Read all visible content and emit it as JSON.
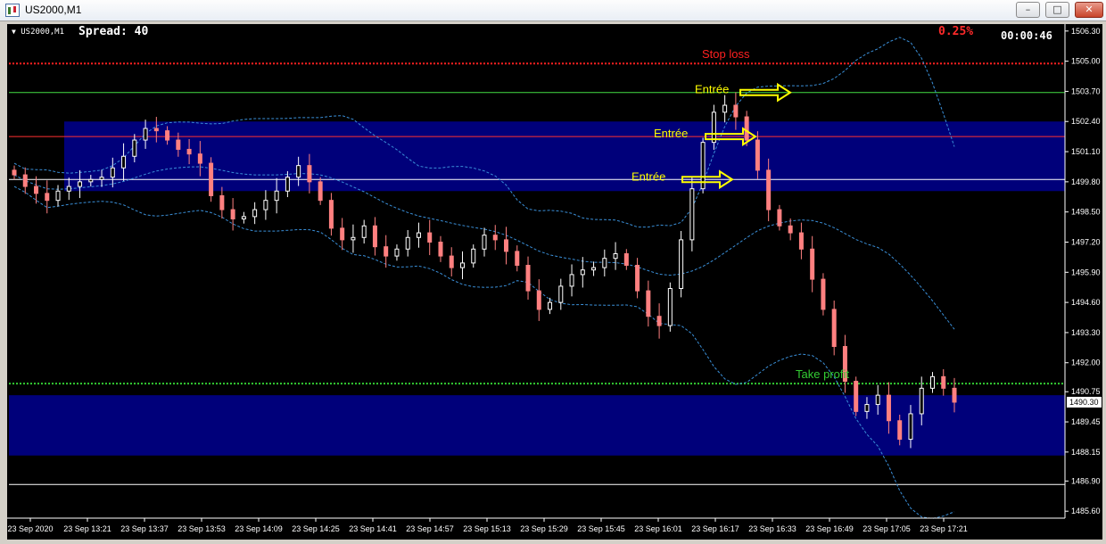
{
  "window": {
    "title": "US2000,M1",
    "buttons": {
      "minimize": "–",
      "restore": "□",
      "close": "✕"
    }
  },
  "header": {
    "symbol": "US2000,M1",
    "spread_text": "Spread: 40",
    "percent": "0.25%",
    "timer": "00:00:46",
    "dropdown_icon": "triangle-down-icon"
  },
  "colors": {
    "background": "#000000",
    "zone": "#00007a",
    "stop_loss": "#ff2020",
    "take_profit": "#33cc33",
    "entry_arrow": "#ffff00",
    "bollinger": "#3a8fd8",
    "bull_candle": "#ffffff",
    "bear_candle": "#ff8080"
  },
  "price_axis": {
    "labels": [
      "1506.30",
      "1505.00",
      "1503.70",
      "1502.40",
      "1501.10",
      "1499.80",
      "1498.50",
      "1497.20",
      "1495.90",
      "1494.60",
      "1493.30",
      "1492.00",
      "1490.75",
      "1489.45",
      "1488.15",
      "1486.90",
      "1485.60"
    ],
    "current_price": "1490.30"
  },
  "time_axis": {
    "labels": [
      "23 Sep 2020",
      "23 Sep 13:21",
      "23 Sep 13:37",
      "23 Sep 13:53",
      "23 Sep 14:09",
      "23 Sep 14:25",
      "23 Sep 14:41",
      "23 Sep 14:57",
      "23 Sep 15:13",
      "23 Sep 15:29",
      "23 Sep 15:45",
      "23 Sep 16:01",
      "23 Sep 16:17",
      "23 Sep 16:33",
      "23 Sep 16:49",
      "23 Sep 17:05",
      "23 Sep 17:21"
    ]
  },
  "annotations": {
    "stop_loss": "Stop loss",
    "take_profit": "Take profit",
    "entries": [
      "Entrée",
      "Entrée",
      "Entrée"
    ]
  },
  "chart_data": {
    "type": "candlestick",
    "symbol": "US2000",
    "timeframe": "M1",
    "y_range": [
      1485.3,
      1506.6
    ],
    "levels": {
      "stop_loss": 1504.9,
      "entry_1": 1503.65,
      "entry_2": 1501.75,
      "entry_3": 1499.9,
      "take_profit": 1491.1,
      "line_1486": 1486.75
    },
    "zones": [
      {
        "from": 1499.4,
        "to": 1502.4,
        "start_time": "23 Sep 13:21"
      },
      {
        "from": 1488.0,
        "to": 1490.6,
        "start_time": "23 Sep 2020"
      }
    ],
    "close_series": [
      1500.1,
      1499.6,
      1499.3,
      1499.0,
      1499.4,
      1499.6,
      1499.8,
      1499.9,
      1500.0,
      1500.4,
      1500.9,
      1501.6,
      1502.1,
      1502.0,
      1501.6,
      1501.2,
      1501.0,
      1500.6,
      1499.2,
      1498.6,
      1498.2,
      1498.3,
      1498.6,
      1499.0,
      1499.4,
      1500.0,
      1500.5,
      1499.8,
      1499.0,
      1497.8,
      1497.3,
      1497.4,
      1497.9,
      1497.0,
      1496.6,
      1496.9,
      1497.4,
      1497.6,
      1497.2,
      1496.6,
      1496.1,
      1496.3,
      1496.9,
      1497.5,
      1497.3,
      1496.8,
      1496.2,
      1495.1,
      1494.3,
      1494.6,
      1495.3,
      1495.8,
      1496.0,
      1496.1,
      1496.5,
      1496.7,
      1496.2,
      1495.1,
      1494.0,
      1493.6,
      1495.2,
      1497.3,
      1499.5,
      1501.5,
      1502.8,
      1503.1,
      1502.6,
      1501.6,
      1500.3,
      1498.6,
      1497.9,
      1497.6,
      1496.9,
      1495.6,
      1494.3,
      1492.7,
      1491.2,
      1489.9,
      1490.2,
      1490.6,
      1489.5,
      1488.7,
      1489.8,
      1490.9,
      1491.4,
      1490.9,
      1490.3
    ],
    "bollinger": {
      "window": 20,
      "deviations": 2
    }
  }
}
